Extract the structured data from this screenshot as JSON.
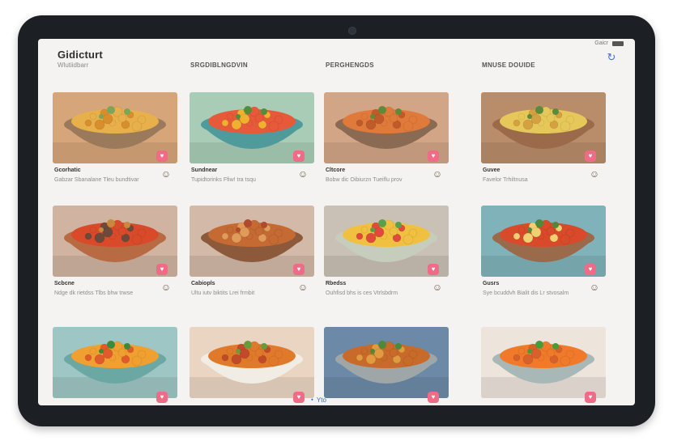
{
  "app": {
    "title": "Gidicturt",
    "subtitle": "Wlutiidbarr"
  },
  "columns": [
    "SRGDIBLNGDVIN",
    "PERGHENGDS",
    "MNUSE DOUIDE"
  ],
  "status": {
    "text": "Gaicr"
  },
  "bottom_nav": {
    "label": "Yto"
  },
  "colors": {
    "accent": "#4a6fd0",
    "badge": "#ef6b86",
    "screen_bg": "#f4f3f1",
    "bezel": "#1c1f24"
  },
  "cards": [
    {
      "title": "Gcorhatic",
      "desc": "Gabzar Sbanalane Tleu bundtivar",
      "bg": "#d7a57a",
      "bowl": "#9a7a5a",
      "food": "#e8b04a",
      "food2": "#d88e2a",
      "garnish": "#7aa55a"
    },
    {
      "title": "Sundnear",
      "desc": "Tupidtorinks Ffiw! tra tsqu",
      "bg": "#a9ccb6",
      "bowl": "#4f9a9a",
      "food": "#e65a3a",
      "food2": "#f0b030",
      "garnish": "#4f8f3a"
    },
    {
      "title": "Cltcore",
      "desc": "Bobw dic Oibiurzn Tueiflu prov",
      "bg": "#d2a586",
      "bowl": "#8a6a52",
      "food": "#e07a3a",
      "food2": "#c05a2a",
      "garnish": "#5f8a3a"
    },
    {
      "title": "Guvee",
      "desc": "Favelor Trhiltnusa",
      "bg": "#b98d6a",
      "bowl": "#9a6a4a",
      "food": "#e6c85a",
      "food2": "#d4a040",
      "garnish": "#5a8a3a"
    },
    {
      "title": "Scbcne",
      "desc": "Ndge dk rietdss Tlbs bhw trwse",
      "bg": "#d0b3a0",
      "bowl": "#b86a42",
      "food": "#d84a2a",
      "food2": "#6a4a3a",
      "garnish": "#c88a3a"
    },
    {
      "title": "Cabiopls",
      "desc": "Ultu iutv biktits Lrei frmbit",
      "bg": "#d3b9a8",
      "bowl": "#8c5a3a",
      "food": "#c46a32",
      "food2": "#e09a5a",
      "garnish": "#b04a2a"
    },
    {
      "title": "Rbedss",
      "desc": "Ouhfisd bhs is ces Vtrlsbdrm",
      "bg": "#c9c1b5",
      "bowl": "#c7cdbd",
      "food": "#f0c040",
      "food2": "#e04a3a",
      "garnish": "#5aa04a"
    },
    {
      "title": "Gusrs",
      "desc": "Sye bcuddvh Bialit dis Lr stvosalm",
      "bg": "#7fb3b9",
      "bowl": "#9a6a4a",
      "food": "#d84a2a",
      "food2": "#f0d070",
      "garnish": "#4f8a3a"
    },
    {
      "title": "",
      "desc": "",
      "bg": "#9ec6c4",
      "bowl": "#6ba8a4",
      "food": "#f0a030",
      "food2": "#e05a2a",
      "garnish": "#3f8a3a"
    },
    {
      "title": "",
      "desc": "",
      "bg": "#ead5c2",
      "bowl": "#f1ede5",
      "food": "#e07a2a",
      "food2": "#c04a2a",
      "garnish": "#6a9a3a"
    },
    {
      "title": "",
      "desc": "",
      "bg": "#6c8aa8",
      "bowl": "#9fa6a8",
      "food": "#c86a2a",
      "food2": "#e09a40",
      "garnish": "#4a8a3a"
    },
    {
      "title": "",
      "desc": "",
      "bg": "#ede4dc",
      "bowl": "#a8b8b6",
      "food": "#f07a2a",
      "food2": "#d8602a",
      "garnish": "#4a9a3a"
    }
  ]
}
